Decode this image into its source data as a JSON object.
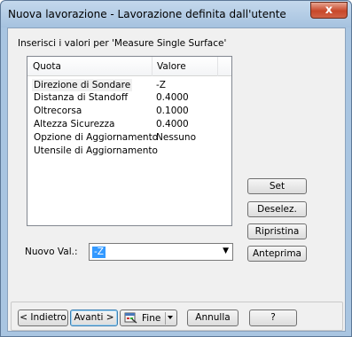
{
  "window": {
    "title": "Nuova lavorazione - Lavorazione definita dall'utente",
    "close_glyph": "x"
  },
  "instruction": "Inserisci i valori per 'Measure Single Surface'",
  "table": {
    "columns": [
      "Quota",
      "Valore"
    ],
    "rows": [
      {
        "quota": "Direzione di Sondare",
        "valore": "-Z"
      },
      {
        "quota": "Distanza di Standoff",
        "valore": "0.4000"
      },
      {
        "quota": "Oltrecorsa",
        "valore": "0.1000"
      },
      {
        "quota": "Altezza Sicurezza",
        "valore": "0.4000"
      },
      {
        "quota": "Opzione di Aggiornamento",
        "valore": "Nessuno"
      },
      {
        "quota": "Utensile di Aggiornamento",
        "valore": ""
      }
    ],
    "selected_row": 0
  },
  "side_buttons": {
    "set": "Set",
    "deselez": "Deselez.",
    "ripristina": "Ripristina",
    "anteprima": "Anteprima"
  },
  "nuovo_val": {
    "label": "Nuovo Val.:",
    "value": "-Z"
  },
  "footer": {
    "indietro": "< Indietro",
    "avanti": "Avanti >",
    "fine": "Fine",
    "annulla": "Annulla",
    "help": "?"
  },
  "colors": {
    "selection": "#3399ff",
    "dialog_bg": "#f0f0f0",
    "frame": "#a9c5e1"
  }
}
